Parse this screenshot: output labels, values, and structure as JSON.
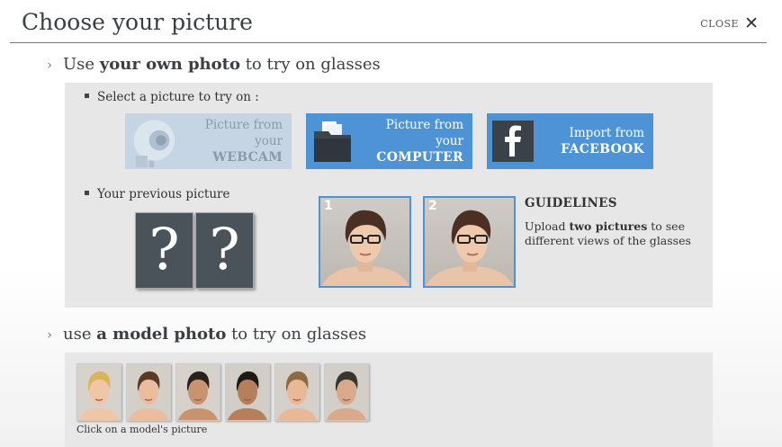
{
  "dialog": {
    "title": "Choose your picture",
    "close_label": "CLOSE",
    "close_glyph": "✕"
  },
  "own_photo_section": {
    "prefix": "Use",
    "bold": "your own photo",
    "suffix": "to try on glasses",
    "select_label": "Select a picture to try on :",
    "buttons": [
      {
        "icon": "webcam-icon",
        "line1": "Picture from your",
        "line2": "WEBCAM",
        "state": "disabled"
      },
      {
        "icon": "folder-icon",
        "line1": "Picture from your",
        "line2": "COMPUTER",
        "state": "enabled"
      },
      {
        "icon": "facebook-icon",
        "line1": "Import from",
        "line2": "FACEBOOK",
        "state": "enabled"
      }
    ],
    "previous_label": "Your previous picture",
    "previous_placeholders": [
      "?",
      "?"
    ],
    "examples": [
      {
        "number": "1"
      },
      {
        "number": "2"
      }
    ],
    "guidelines_title": "GUIDELINES",
    "guidelines_pre": "Upload",
    "guidelines_bold": "two pictures",
    "guidelines_post": "to see different views of the glasses"
  },
  "model_section": {
    "prefix": "use",
    "bold": "a model photo",
    "suffix": "to try on glasses",
    "caption": "Click on a model's picture",
    "models": [
      {
        "hair": "#d9b45a",
        "skin": "#f0c6a6",
        "bg": "#d7d2cc"
      },
      {
        "hair": "#5a3a25",
        "skin": "#e9bd9d",
        "bg": "#d4cfc9"
      },
      {
        "hair": "#2b211c",
        "skin": "#c8946f",
        "bg": "#d6d1cb"
      },
      {
        "hair": "#1f1915",
        "skin": "#b57f5b",
        "bg": "#d2cdc7"
      },
      {
        "hair": "#8d6a42",
        "skin": "#e8b897",
        "bg": "#d5d0ca"
      },
      {
        "hair": "#3b3530",
        "skin": "#d8aa8b",
        "bg": "#d3cec8"
      }
    ]
  },
  "colors": {
    "accent": "#4d93d6",
    "panel": "#e7e7e7",
    "dark_box": "#4a525a"
  }
}
